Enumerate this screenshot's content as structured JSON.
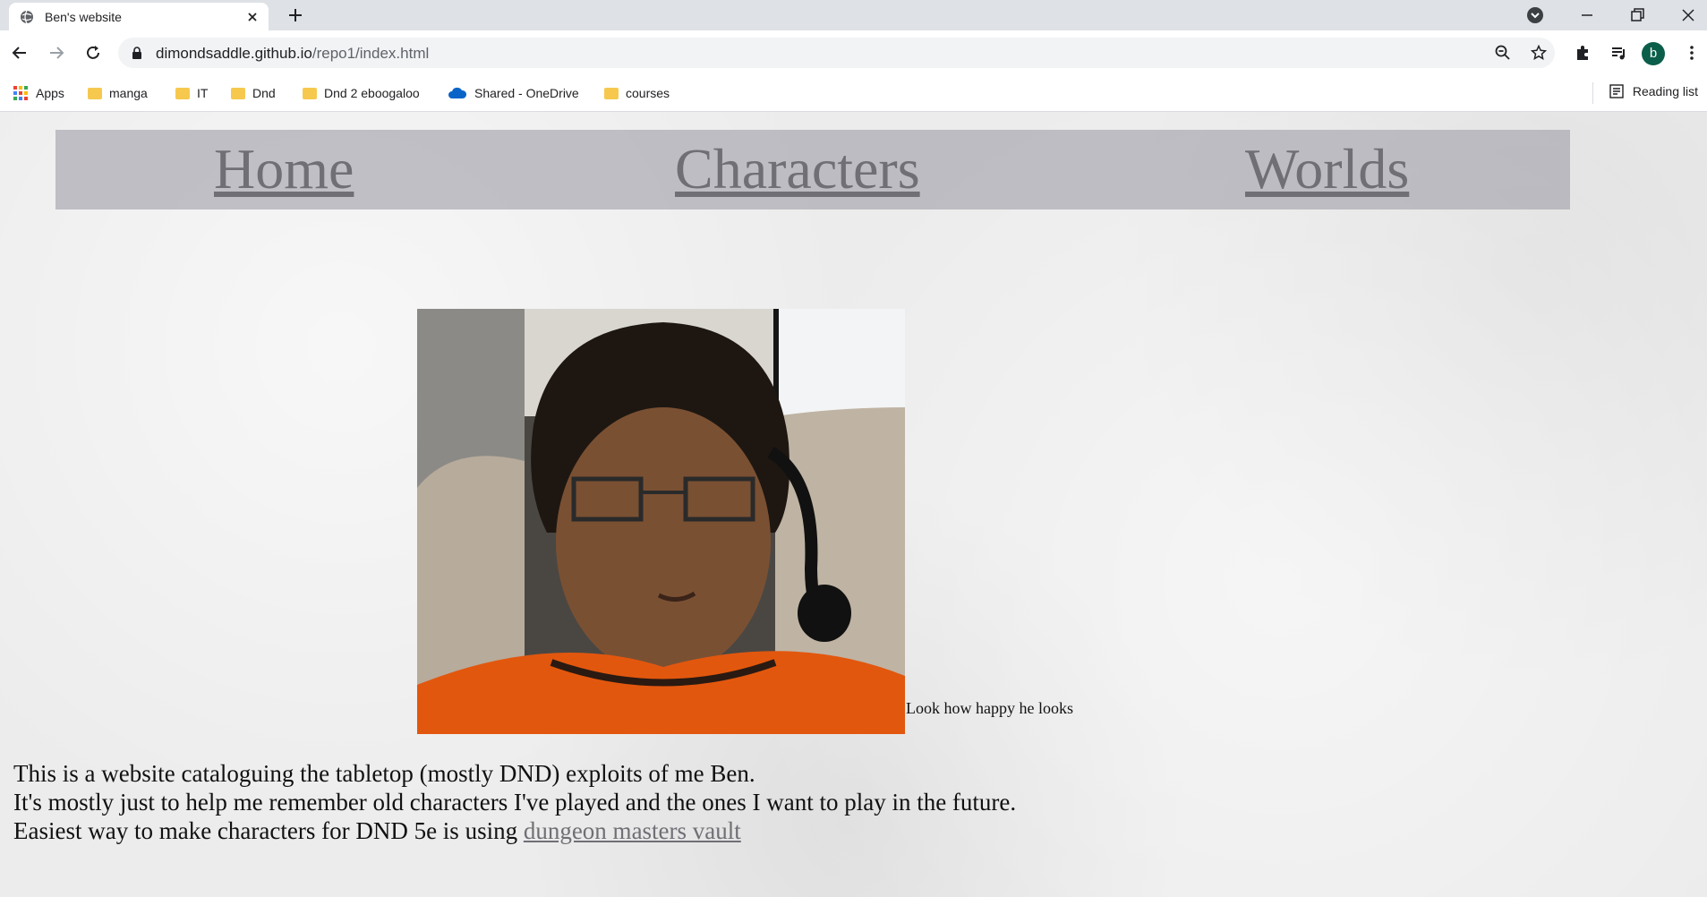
{
  "browser": {
    "tab_title": "Ben's website",
    "url_domain": "dimondsaddle.github.io",
    "url_path": "/repo1/index.html",
    "profile_initial": "b",
    "bookmarks": [
      "Apps",
      "manga",
      "IT",
      "Dnd",
      "Dnd 2 eboogaloo",
      "Shared - OneDrive",
      "courses"
    ],
    "reading_list": "Reading list"
  },
  "nav": {
    "home": "Home",
    "characters": "Characters",
    "worlds": "Worlds"
  },
  "main": {
    "photo_caption": "Look how happy he looks",
    "line1": "This is a website cataloguing the tabletop (mostly DND) exploits of me Ben.",
    "line2": "It's mostly just to help me remember old characters I've played and the ones I want to play in the future.",
    "line3_prefix": "Easiest way to make characters for DND 5e is using ",
    "line3_link": "dungeon masters vault"
  },
  "colors": {
    "nav_bar": "#a8a8b0",
    "link": "#6f6f75",
    "avatar": "#0b5e4a"
  }
}
